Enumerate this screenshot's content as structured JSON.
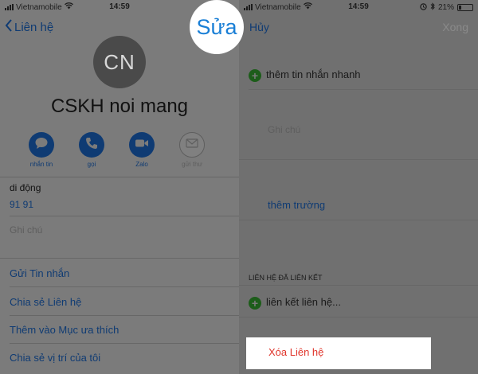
{
  "left": {
    "status": {
      "carrier": "Vietnamobile",
      "time": "14:59"
    },
    "back_label": "Liên hệ",
    "avatar_initials": "CN",
    "contact_name": "CSKH noi mang",
    "actions": [
      {
        "label": "nhắn tin",
        "icon": "message-icon",
        "enabled": true
      },
      {
        "label": "gọi",
        "icon": "phone-icon",
        "enabled": true
      },
      {
        "label": "Zalo",
        "icon": "video-icon",
        "enabled": true
      },
      {
        "label": "gửi thư",
        "icon": "mail-icon",
        "enabled": false
      }
    ],
    "phone_label": "di động",
    "phone_value": "91 91",
    "notes_label": "Ghi chú",
    "menu": [
      "Gửi Tin nhắn",
      "Chia sẻ Liên hệ",
      "Thêm vào Mục ưa thích",
      "Chia sẻ vị trí của tôi"
    ]
  },
  "edit_button": "Sửa",
  "right": {
    "status": {
      "carrier": "Vietnamobile",
      "time": "14:59",
      "battery": "21%"
    },
    "cancel_label": "Hủy",
    "done_label": "Xong",
    "add_quick_message": "thêm tin nhắn nhanh",
    "notes_placeholder": "Ghi chú",
    "add_field": "thêm trường",
    "linked_header": "LIÊN HỆ ĐÃ LIÊN KẾT",
    "link_contact": "liên kết liên hệ...",
    "delete_contact": "Xóa Liên hệ"
  },
  "colors": {
    "ios_blue": "#1a7fd6",
    "delete_red": "#e0352b"
  }
}
